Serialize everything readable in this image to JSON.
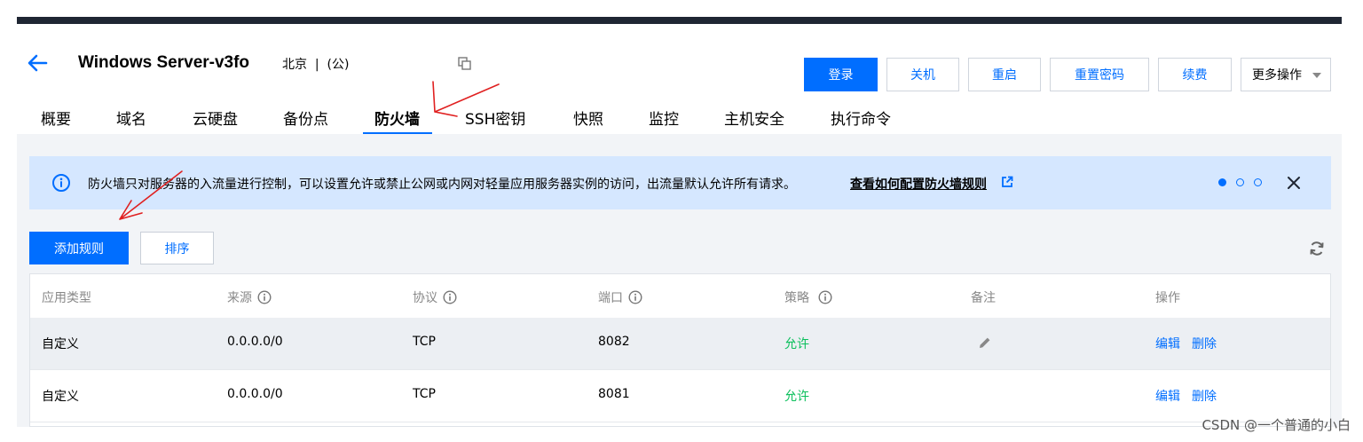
{
  "header": {
    "server_name": "Windows Server-v3fo",
    "region": "北京  |  (公)",
    "buttons": {
      "login": "登录",
      "shutdown": "关机",
      "restart": "重启",
      "reset_password": "重置密码",
      "renew": "续费",
      "more": "更多操作"
    }
  },
  "tabs": [
    {
      "label": "概要"
    },
    {
      "label": "域名"
    },
    {
      "label": "云硬盘"
    },
    {
      "label": "备份点"
    },
    {
      "label": "防火墙",
      "active": true
    },
    {
      "label": "SSH密钥"
    },
    {
      "label": "快照"
    },
    {
      "label": "监控"
    },
    {
      "label": "主机安全"
    },
    {
      "label": "执行命令"
    }
  ],
  "notice": {
    "text": "防火墙只对服务器的入流量进行控制，可以设置允许或禁止公网或内网对轻量应用服务器实例的访问，出流量默认允许所有请求。",
    "link": "查看如何配置防火墙规则"
  },
  "toolbar": {
    "add_rule": "添加规则",
    "sort": "排序"
  },
  "table": {
    "columns": [
      "应用类型",
      "来源",
      "协议",
      "端口",
      "策略",
      "备注",
      "操作"
    ],
    "rows": [
      {
        "type": "自定义",
        "source": "0.0.0.0/0",
        "protocol": "TCP",
        "port": "8082",
        "policy": "允许",
        "edit": "编辑",
        "delete": "删除"
      },
      {
        "type": "自定义",
        "source": "0.0.0.0/0",
        "protocol": "TCP",
        "port": "8081",
        "policy": "允许",
        "edit": "编辑",
        "delete": "删除"
      }
    ]
  },
  "watermark": "CSDN @一个普通的小白",
  "colors": {
    "primary": "#006eff",
    "allow": "#0abf5b",
    "notice_bg": "#d5e7ff",
    "annotation": "#e02020"
  }
}
